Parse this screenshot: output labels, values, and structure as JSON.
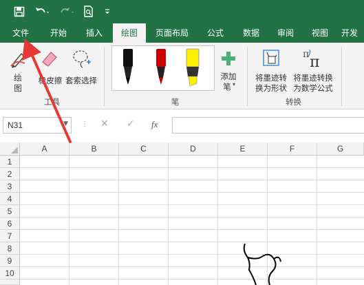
{
  "ribbon_tabs": [
    "文件",
    "开始",
    "插入",
    "绘图",
    "页面布局",
    "公式",
    "数据",
    "审阅",
    "视图",
    "开发"
  ],
  "active_tab": "绘图",
  "tools": {
    "draw": [
      "绘",
      "图"
    ],
    "eraser": "橡皮擦",
    "lasso": "套索选择",
    "group": "工具"
  },
  "pens": {
    "add": [
      "添加",
      "笔"
    ],
    "group": "笔",
    "colors": [
      "#000000",
      "#d00000",
      "#ffef00"
    ]
  },
  "convert": {
    "to_shape": [
      "将墨迹转",
      "换为形状"
    ],
    "to_math": [
      "将墨迹转换",
      "为数学公式"
    ],
    "group": "转换"
  },
  "formula_bar": {
    "name_box": "N31",
    "fx": "fx",
    "value": ""
  },
  "columns": [
    "A",
    "B",
    "C",
    "D",
    "E",
    "F",
    "G"
  ],
  "rows": [
    "1",
    "2",
    "3",
    "4",
    "5",
    "6",
    "7",
    "8",
    "9",
    "10"
  ],
  "colors": {
    "brand": "#217346",
    "annotation_arrow": "#e53935"
  }
}
